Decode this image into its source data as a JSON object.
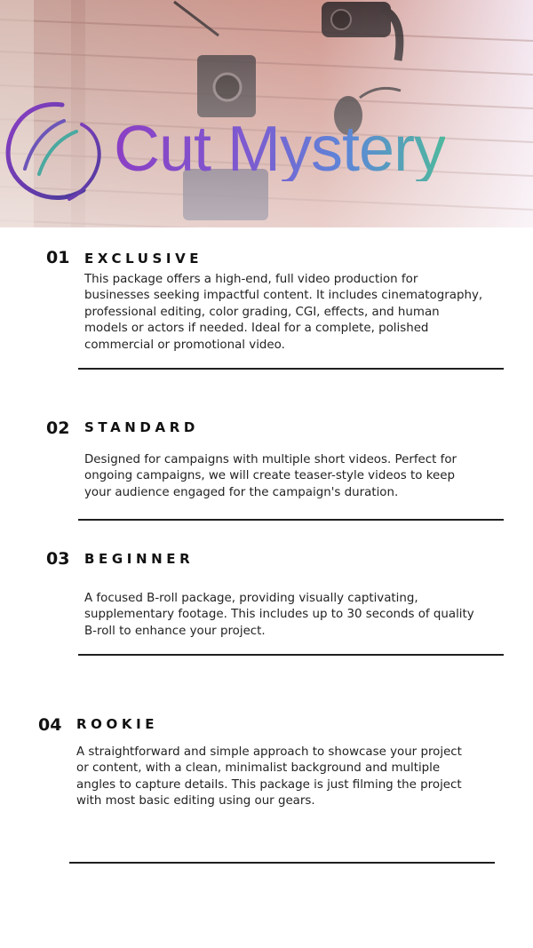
{
  "brand": {
    "name": "Cut Mystery"
  },
  "icons": {
    "logo": "swoosh-circle-icon"
  },
  "colors": {
    "brand_purple": "#8b3fc4",
    "brand_teal": "#4fb89e",
    "rule": "#1f1f1f"
  },
  "packages": [
    {
      "number": "01",
      "title": "EXCLUSIVE",
      "description": "This package offers a high-end, full video production for businesses seeking impactful content. It includes cinematography, professional editing, color grading, CGI, effects, and human models or actors if needed. Ideal for a complete, polished commercial or promotional video."
    },
    {
      "number": "02",
      "title": "STANDARD",
      "description": "Designed for campaigns with multiple short videos. Perfect for ongoing campaigns, we will create teaser-style videos to keep your audience engaged for the campaign's duration."
    },
    {
      "number": "03",
      "title": "BEGINNER",
      "description": "A focused B-roll package, providing visually captivating, supplementary footage. This includes up to 30 seconds of quality B-roll to enhance your project."
    },
    {
      "number": "04",
      "title": "ROOKIE",
      "description": "A straightforward and simple approach to showcase your project or content, with a clean, minimalist background and multiple angles to capture details. This package is just filming the project with most basic editing using our gears."
    }
  ]
}
